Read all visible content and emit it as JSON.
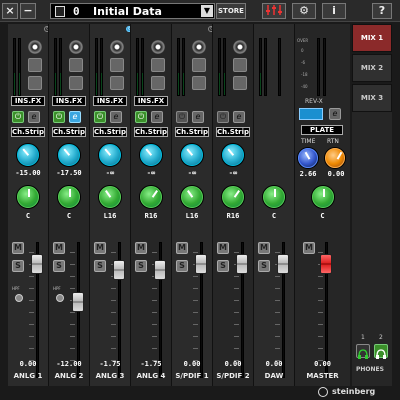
{
  "titlebar": {
    "close_label": "×",
    "minimize_label": "−",
    "scene_number": "0",
    "scene_name": "Initial Data",
    "dropdown_label": "▼",
    "store_label": "STORE",
    "help_label": "?",
    "info_label": "i",
    "mixer_icon": "mixer-icon",
    "settings_icon": "gear-icon"
  },
  "channels": [
    {
      "name": "ANLG 1",
      "fx": "INS.FX",
      "strip": "Ch.Strip",
      "gain": "-15.00",
      "pan": "C",
      "level": "0.00",
      "hpf": "HPF",
      "link_on": false
    },
    {
      "name": "ANLG 2",
      "fx": "INS.FX",
      "strip": "Ch.Strip",
      "gain": "-17.50",
      "pan": "C",
      "level": "-12.00",
      "hpf": "HPF",
      "link_on": false
    },
    {
      "name": "ANLG 3",
      "fx": "INS.FX",
      "strip": "Ch.Strip",
      "gain": "-∞",
      "pan": "L16",
      "level": "-1.75",
      "link_on": true
    },
    {
      "name": "ANLG 4",
      "fx": "INS.FX",
      "strip": "Ch.Strip",
      "gain": "-∞",
      "pan": "R16",
      "level": "-1.75",
      "link_on": true
    },
    {
      "name": "S/PDIF 1",
      "strip": "Ch.Strip",
      "gain": "-∞",
      "pan": "L16",
      "level": "0.00",
      "link_on": false
    },
    {
      "name": "S/PDIF 2",
      "strip": "Ch.Strip",
      "gain": "-∞",
      "pan": "R16",
      "level": "0.00",
      "link_on": false
    },
    {
      "name": "DAW",
      "pan": "C",
      "level": "0.00"
    },
    {
      "name": "MASTER",
      "pan": "C",
      "level": "0.00"
    }
  ],
  "master": {
    "reverb_label": "REV-X",
    "reverb_type": "PLATE",
    "time_label": "TIME",
    "rtn_label": "RTN",
    "time_value": "2.66",
    "rtn_value": "0.00",
    "scale_over": "OVER",
    "scale": [
      "0",
      "-6",
      "-18",
      "-40"
    ]
  },
  "mix_tabs": [
    "MIX 1",
    "MIX 2",
    "MIX 3"
  ],
  "phones": {
    "label": "PHONES",
    "one": "1",
    "two": "2"
  },
  "brand": "steinberg",
  "colors": {
    "accent_cyan": "#2ac",
    "accent_green": "#3a3",
    "active_tab": "#8b2a2a"
  }
}
